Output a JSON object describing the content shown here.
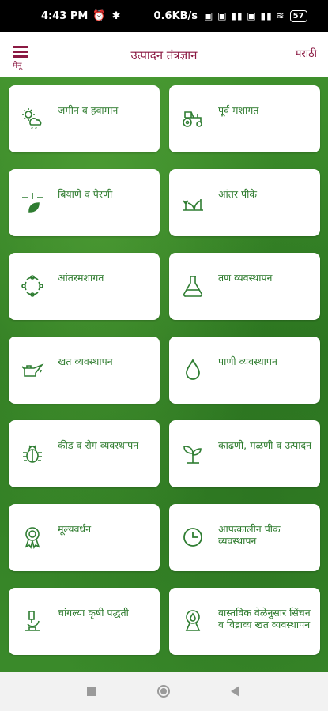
{
  "status_bar": {
    "time": "4:43 PM",
    "left_icons": "⏰ ✱",
    "network_speed": "0.6KB/s",
    "right_icons": "▣ ▣ ▮▮ ▣ ▮▮ ≋",
    "battery": "57"
  },
  "header": {
    "menu_label": "मेनू",
    "title": "उत्पादन तंत्रज्ञान",
    "language": "मराठी"
  },
  "cards": [
    {
      "label": "जमीन व हवामान",
      "icon": "weather-icon"
    },
    {
      "label": "पूर्व मशागत",
      "icon": "tractor-icon"
    },
    {
      "label": "बियाणे व पेरणी",
      "icon": "sowing-icon"
    },
    {
      "label": "आंतर पीके",
      "icon": "intercrop-icon"
    },
    {
      "label": "आंतरमशागत",
      "icon": "cycle-icon"
    },
    {
      "label": "तण व्यवस्थापन",
      "icon": "flask-icon"
    },
    {
      "label": "खत व्यवस्थापन",
      "icon": "oilcan-icon"
    },
    {
      "label": "पाणी व्यवस्थापन",
      "icon": "water-drop-icon"
    },
    {
      "label": "कीड व रोग व्यवस्थापन",
      "icon": "bug-icon"
    },
    {
      "label": "काढणी, मळणी व उत्पादन",
      "icon": "sprout-icon"
    },
    {
      "label": "मूल्यवर्धन",
      "icon": "award-icon"
    },
    {
      "label": "आपत्कालीन पीक व्यवस्थापन",
      "icon": "clock-icon"
    },
    {
      "label": "चांगल्या कृषी पद्धती",
      "icon": "microscope-icon"
    },
    {
      "label": "वास्तविक वेळेनुसार सिंचन व विद्राव्य खत व्यवस्थापन",
      "icon": "irrigation-icon"
    }
  ],
  "colors": {
    "accent": "#8b1a43",
    "label_green": "#2c7a2c",
    "icon_green": "#2f7d32"
  }
}
